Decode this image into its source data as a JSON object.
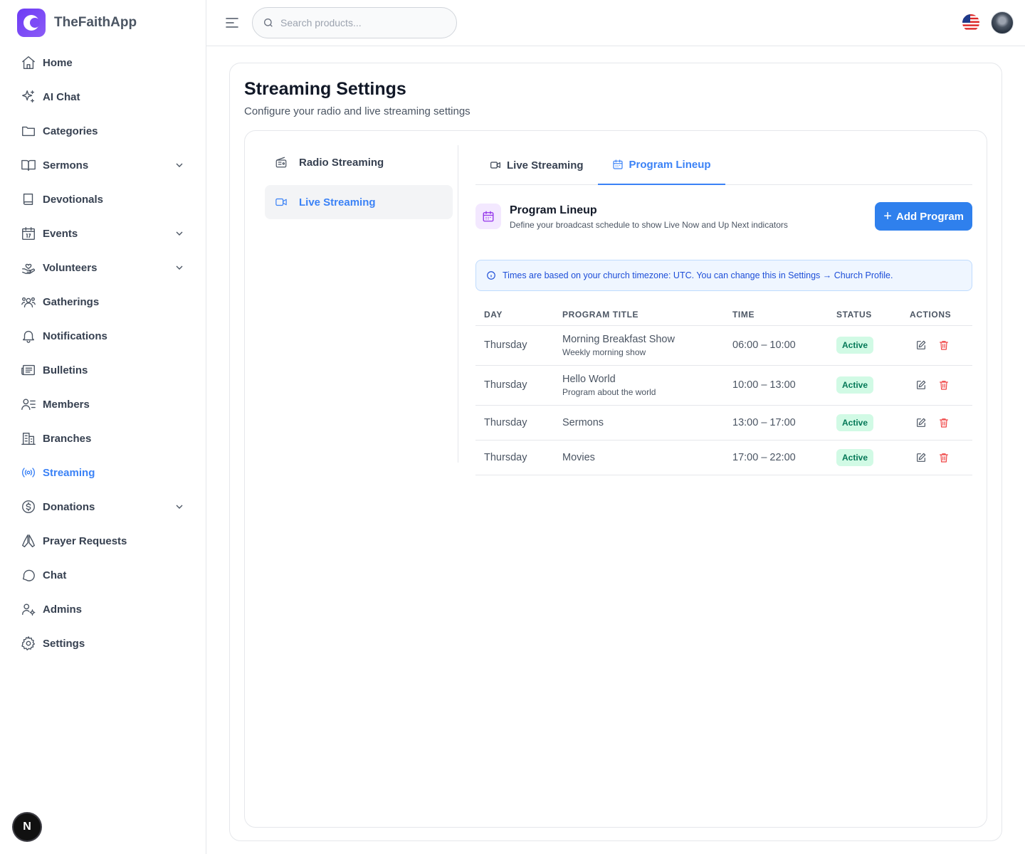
{
  "app": {
    "name": "TheFaithApp"
  },
  "sidebar": {
    "items": [
      {
        "label": "Home",
        "icon": "home-icon",
        "expandable": false
      },
      {
        "label": "AI Chat",
        "icon": "sparkles-icon",
        "expandable": false
      },
      {
        "label": "Categories",
        "icon": "folder-icon",
        "expandable": false
      },
      {
        "label": "Sermons",
        "icon": "book-open-icon",
        "expandable": true
      },
      {
        "label": "Devotionals",
        "icon": "book-icon",
        "expandable": false
      },
      {
        "label": "Events",
        "icon": "calendar-icon",
        "expandable": true
      },
      {
        "label": "Volunteers",
        "icon": "hand-heart-icon",
        "expandable": true
      },
      {
        "label": "Gatherings",
        "icon": "users-icon",
        "expandable": false
      },
      {
        "label": "Notifications",
        "icon": "bell-icon",
        "expandable": false
      },
      {
        "label": "Bulletins",
        "icon": "newspaper-icon",
        "expandable": false
      },
      {
        "label": "Members",
        "icon": "user-list-icon",
        "expandable": false
      },
      {
        "label": "Branches",
        "icon": "building-icon",
        "expandable": false
      },
      {
        "label": "Streaming",
        "icon": "broadcast-icon",
        "expandable": false,
        "active": true
      },
      {
        "label": "Donations",
        "icon": "dollar-circle-icon",
        "expandable": true
      },
      {
        "label": "Prayer Requests",
        "icon": "praying-hands-icon",
        "expandable": false
      },
      {
        "label": "Chat",
        "icon": "chat-bubble-icon",
        "expandable": false
      },
      {
        "label": "Admins",
        "icon": "user-cog-icon",
        "expandable": false
      },
      {
        "label": "Settings",
        "icon": "gear-icon",
        "expandable": false
      }
    ]
  },
  "topbar": {
    "search_placeholder": "Search products..."
  },
  "page": {
    "title": "Streaming Settings",
    "subtitle": "Configure your radio and live streaming settings"
  },
  "side_tabs": [
    {
      "label": "Radio Streaming",
      "icon": "radio-icon"
    },
    {
      "label": "Live Streaming",
      "icon": "video-icon",
      "active": true
    }
  ],
  "tabs": [
    {
      "label": "Live Streaming",
      "icon": "video-icon"
    },
    {
      "label": "Program Lineup",
      "icon": "calendar-icon",
      "active": true
    }
  ],
  "lineup": {
    "title": "Program Lineup",
    "subtitle": "Define your broadcast schedule to show Live Now and Up Next indicators",
    "add_button": "Add Program",
    "info": "Times are based on your church timezone: UTC. You can change this in Settings → Church Profile.",
    "columns": [
      "DAY",
      "PROGRAM TITLE",
      "TIME",
      "STATUS",
      "ACTIONS"
    ],
    "rows": [
      {
        "day": "Thursday",
        "title": "Morning Breakfast Show",
        "description": "Weekly morning show",
        "time": "06:00 – 10:00",
        "status": "Active"
      },
      {
        "day": "Thursday",
        "title": "Hello World",
        "description": "Program about the world",
        "time": "10:00 – 13:00",
        "status": "Active"
      },
      {
        "day": "Thursday",
        "title": "Sermons",
        "description": "",
        "time": "13:00 – 17:00",
        "status": "Active"
      },
      {
        "day": "Thursday",
        "title": "Movies",
        "description": "",
        "time": "17:00 – 22:00",
        "status": "Active"
      }
    ]
  },
  "dev_badge": "N",
  "colors": {
    "accent": "#3b82f6",
    "brand": "#7c4af6",
    "button": "#2f80ed",
    "active_badge_bg": "#d1fae5",
    "active_badge_text": "#047857",
    "danger": "#ef4444"
  }
}
